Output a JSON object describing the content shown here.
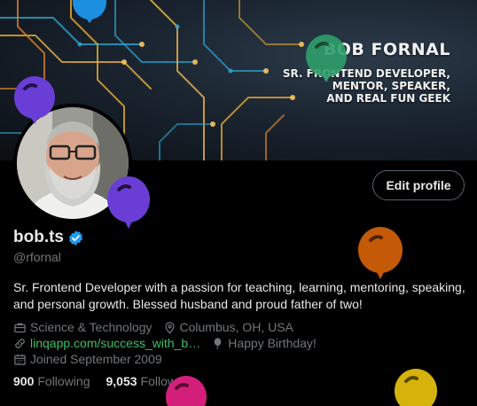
{
  "banner": {
    "name": "BOB FORNAL",
    "tagline_lines": [
      "SR. FRONTEND DEVELOPER,",
      "MENTOR, SPEAKER,",
      "AND REAL FUN GEEK"
    ]
  },
  "profile": {
    "display_name": "bob.ts",
    "handle": "@rfornal",
    "bio": "Sr. Frontend Developer with a passion for teaching, learning, mentoring, speaking, and personal growth. Blessed husband and proud father of two!",
    "category": "Science & Technology",
    "location": "Columbus, OH, USA",
    "website": "linqapp.com/success_with_b…",
    "birthday": "Happy Birthday!",
    "joined": "Joined September 2009",
    "following_count": "900",
    "following_label": "Following",
    "followers_count": "9,053",
    "followers_label": "Followers"
  },
  "actions": {
    "edit_profile": "Edit profile"
  },
  "icons": {
    "verified": "verified-badge-icon",
    "category": "briefcase-icon",
    "location": "location-pin-icon",
    "website": "link-icon",
    "birthday": "balloon-icon",
    "joined": "calendar-icon"
  },
  "colors": {
    "background": "#000000",
    "primary_text": "#e7e9ea",
    "secondary_text": "#71767b",
    "accent_blue": "#1d9bf0",
    "website_green": "#3bbf6a",
    "balloon_blue": "#1d8fe0",
    "balloon_purple": "#6a3ed6",
    "balloon_green": "#2f9e6a",
    "balloon_orange": "#c45a08",
    "balloon_pink": "#d41f7a",
    "balloon_yellow": "#d6b30a"
  }
}
